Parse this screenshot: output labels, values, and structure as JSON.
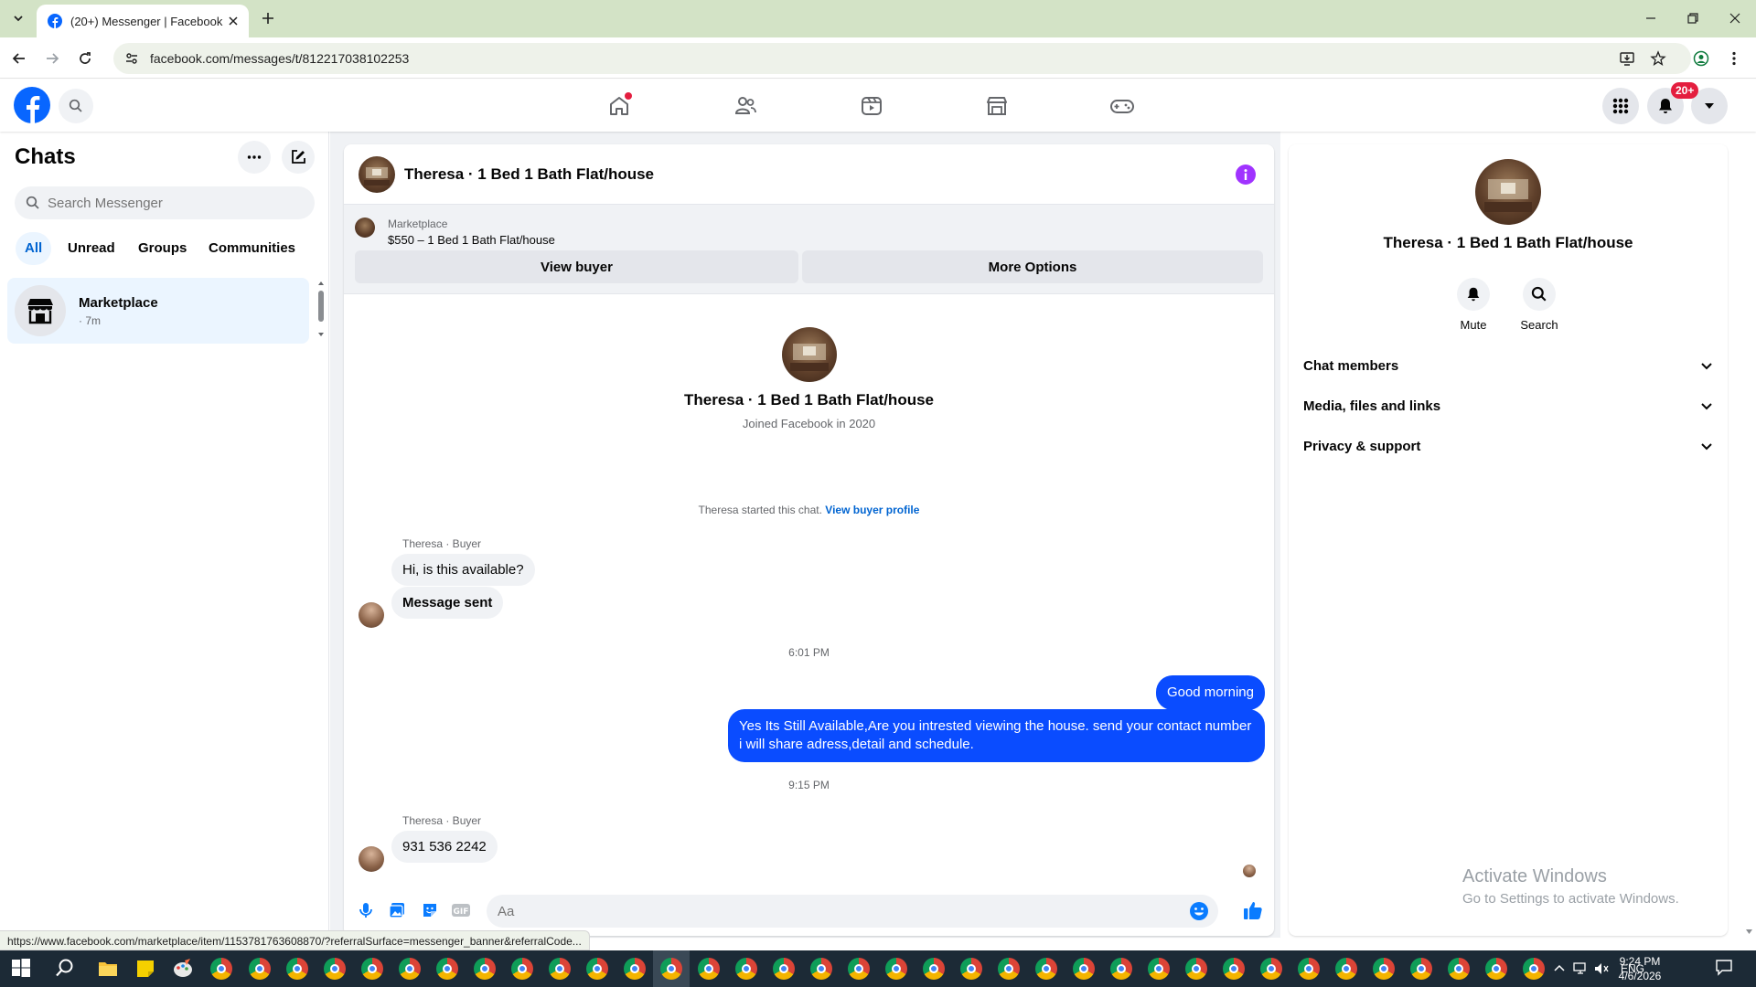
{
  "browser": {
    "tab_title": "(20+) Messenger | Facebook",
    "url": "facebook.com/messages/t/812217038102253"
  },
  "fb_header": {
    "notification_badge": "20+"
  },
  "left_panel": {
    "title": "Chats",
    "search_placeholder": "Search Messenger",
    "filters": [
      "All",
      "Unread",
      "Groups",
      "Communities"
    ],
    "active_filter": "All",
    "chats": [
      {
        "name": "Marketplace",
        "time": "· 7m"
      }
    ]
  },
  "conversation": {
    "title": "Theresa · 1 Bed 1 Bath Flat/house",
    "marketplace": {
      "label": "Marketplace",
      "listing": "$550 – 1 Bed 1 Bath Flat/house",
      "view_buyer": "View buyer",
      "more_options": "More Options"
    },
    "profile": {
      "name": "Theresa · 1 Bed 1 Bath Flat/house",
      "joined": "Joined Facebook in 2020"
    },
    "system_message": "Theresa started this chat.",
    "system_link": "View buyer profile",
    "messages": [
      {
        "sender": "Theresa · Buyer",
        "text": "Hi, is this available?",
        "direction": "in"
      },
      {
        "sender": "",
        "text": "Message sent",
        "direction": "in"
      },
      {
        "time": "6:01 PM"
      },
      {
        "sender": "",
        "text": "Good morning",
        "direction": "out"
      },
      {
        "sender": "",
        "text": "Yes Its Still Available,Are you intrested viewing the house. send your contact number i will share adress,detail and schedule.",
        "direction": "out"
      },
      {
        "time": "9:15 PM"
      },
      {
        "sender": "Theresa · Buyer",
        "text": "931 536 2242",
        "direction": "in"
      }
    ],
    "composer_placeholder": "Aa",
    "colors": {
      "outgoing": "#0a4cff",
      "accent": "#0064d1",
      "info": "#a033ff"
    }
  },
  "right_panel": {
    "name": "Theresa · 1 Bed 1 Bath Flat/house",
    "actions": [
      {
        "label": "Mute",
        "icon": "bell-icon"
      },
      {
        "label": "Search",
        "icon": "search-icon"
      }
    ],
    "sections": [
      "Chat members",
      "Media, files and links",
      "Privacy & support"
    ]
  },
  "watermark": {
    "line1": "Activate Windows",
    "line2": "Go to Settings to activate Windows."
  },
  "status_url": "https://www.facebook.com/marketplace/item/1153781763608870/?referralSurface=messenger_banner&referralCode...",
  "taskbar": {
    "language": "ENG",
    "time": "9:24 PM",
    "date": "4/6/2026"
  }
}
